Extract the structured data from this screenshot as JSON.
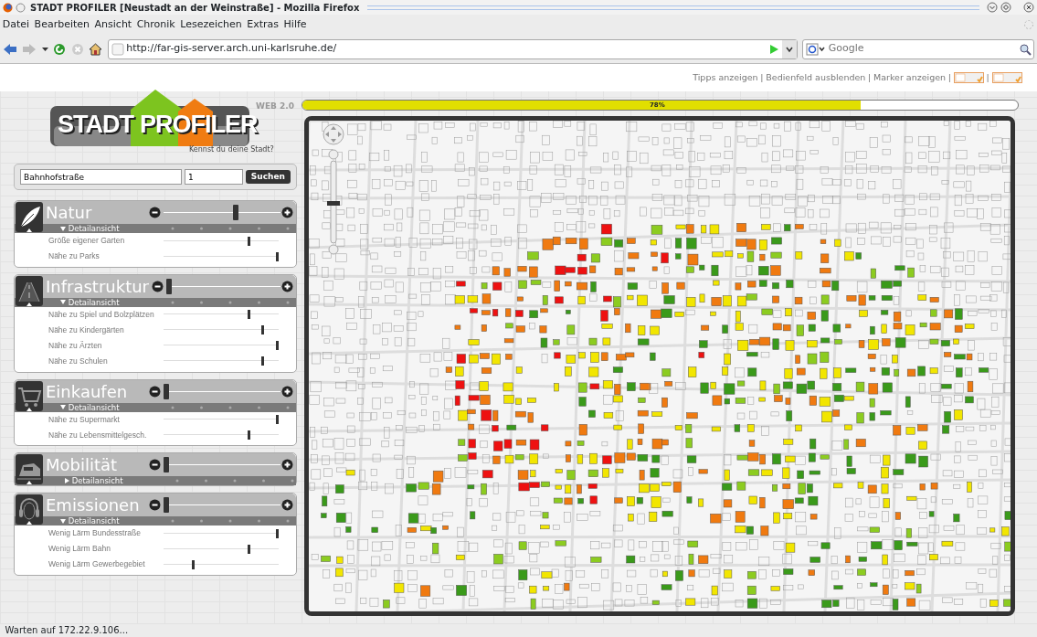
{
  "window": {
    "title": "STADT PROFILER  [Neustadt an der Weinstraße] - Mozilla Firefox"
  },
  "menu": [
    "Datei",
    "Bearbeiten",
    "Ansicht",
    "Chronik",
    "Lesezeichen",
    "Extras",
    "Hilfe"
  ],
  "address_bar": {
    "value": "http://far-gis-server.arch.uni-karlsruhe.de/"
  },
  "search_bar": {
    "placeholder": "Google"
  },
  "top_links": {
    "items": [
      "Tipps anzeigen",
      "Bedienfeld ausblenden",
      "Marker anzeigen"
    ],
    "separator": "|"
  },
  "logo": {
    "word_left": "STADT",
    "word_right": "PROFILER",
    "badge": "WEB 2.0",
    "tagline": "Kennst du deine Stadt?"
  },
  "search": {
    "street": "Bahnhofstraße",
    "number": "1",
    "button": "Suchen"
  },
  "progress": {
    "level": 0.78,
    "label": "78%"
  },
  "categories": [
    {
      "kind": "leaf",
      "name": "Natur",
      "level": 0.62,
      "toggle": "Detailansicht",
      "expanded": true,
      "details": [
        {
          "label": "Größe eigener Garten",
          "level": 0.75
        },
        {
          "label": "Nähe zu Parks",
          "level": 1.0
        }
      ]
    },
    {
      "kind": "road",
      "name": "Infrastruktur",
      "level": 0.0,
      "toggle": "Detailansicht",
      "expanded": true,
      "details": [
        {
          "label": "Nähe zu Spiel und Bolzplätzen",
          "level": 0.75
        },
        {
          "label": "Nähe zu Kindergärten",
          "level": 0.87
        },
        {
          "label": "Nähe zu Ärzten",
          "level": 1.0
        },
        {
          "label": "Nähe zu Schulen",
          "level": 0.87
        }
      ]
    },
    {
      "kind": "cart",
      "name": "Einkaufen",
      "level": 0.0,
      "toggle": "Detailansicht",
      "expanded": true,
      "details": [
        {
          "label": "Nähe zu Supermarkt",
          "level": 1.0
        },
        {
          "label": "Nähe zu Lebensmittelgesch.",
          "level": 0.75
        }
      ]
    },
    {
      "kind": "train",
      "name": "Mobilität",
      "level": 0.0,
      "toggle": "Detailansicht",
      "expanded": false
    },
    {
      "kind": "headphones",
      "name": "Emissionen",
      "level": 0.0,
      "toggle": "Detailansicht",
      "expanded": true,
      "details": [
        {
          "label": "Wenig Lärm Bundesstraße",
          "level": 1.0
        },
        {
          "label": "Wenig Lärm Bahn",
          "level": 0.75
        },
        {
          "label": "Wenig Lärm Gewerbegebiet",
          "level": 0.25
        }
      ]
    }
  ],
  "status_bar": "Warten auf 172.22.9.106..."
}
